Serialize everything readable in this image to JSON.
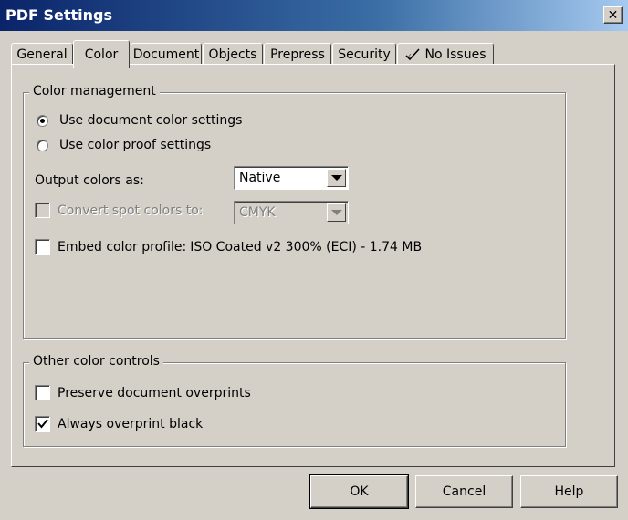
{
  "window": {
    "title": "PDF Settings",
    "close_glyph": "✕"
  },
  "tabs": [
    {
      "label": "General"
    },
    {
      "label": "Color",
      "active": true
    },
    {
      "label": "Document"
    },
    {
      "label": "Objects"
    },
    {
      "label": "Prepress"
    },
    {
      "label": "Security"
    },
    {
      "label": "No Issues",
      "icon": "checkmark-icon"
    }
  ],
  "color_management": {
    "legend": "Color management",
    "radio_document": {
      "label": "Use document color settings",
      "checked": true
    },
    "radio_proof": {
      "label": "Use color proof settings",
      "checked": false
    },
    "output_label": "Output colors as:",
    "output_value": "Native",
    "spot_label": "Convert spot colors to:",
    "spot_value": "CMYK",
    "spot_enabled": false,
    "embed_label": "Embed color profile:",
    "embed_profile": "ISO Coated v2 300% (ECI) - 1.74 MB",
    "embed_checked": false
  },
  "other_controls": {
    "legend": "Other color controls",
    "preserve_label": "Preserve document overprints",
    "preserve_checked": false,
    "black_label": "Always overprint black",
    "black_checked": true
  },
  "buttons": {
    "ok": "OK",
    "cancel": "Cancel",
    "help": "Help"
  },
  "colors": {
    "title_bar": "#0a246a",
    "face": "#d4d0c8"
  }
}
